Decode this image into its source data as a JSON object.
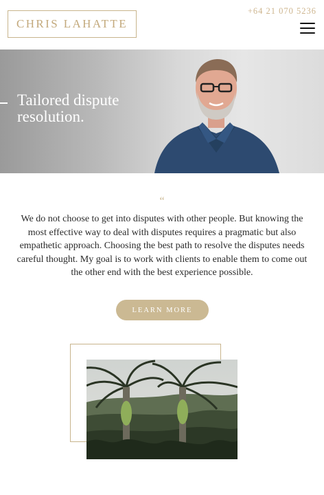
{
  "header": {
    "logo": "CHRIS LAHATTE",
    "phone": "+64 21 070 5236",
    "menu_icon": "hamburger-menu-icon"
  },
  "hero": {
    "title": "Tailored dispute resolution.",
    "portrait": "man-portrait-photo"
  },
  "quote": {
    "mark": "“",
    "text": "We do not choose to get into disputes with other people. But knowing the most effective way to deal with disputes requires a pragmatic but also empathetic approach. Choosing the best path to resolve the disputes needs careful thought. My goal is to work with clients to enable them to come out the other end with the best experience possible."
  },
  "cta": {
    "label": "LEARN MORE"
  },
  "gallery": {
    "image": "nikau-palms-photo"
  },
  "colors": {
    "gold": "#c8b48c",
    "button": "#cbb993",
    "text": "#2a2a2a"
  }
}
